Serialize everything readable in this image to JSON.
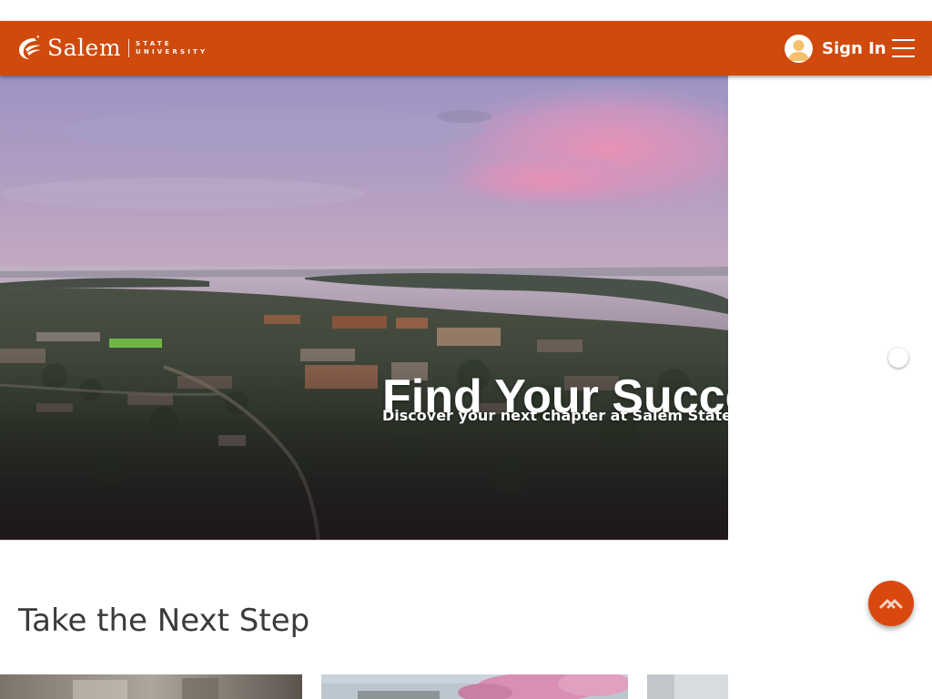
{
  "header": {
    "logo": {
      "wordmark": "Salem",
      "sub_line1": "STATE",
      "sub_line2": "UNIVERSITY"
    },
    "signin_label": "Sign In",
    "menu_icon": "hamburger-menu-icon",
    "avatar_icon": "user-avatar-icon",
    "brand_color": "#cf4a0c"
  },
  "hero": {
    "title": "Find Your Succes",
    "subtitle": "Discover your next chapter at Salem State Unive"
  },
  "section": {
    "title": "Take the Next Step"
  },
  "fab": {
    "icon": "chevron-up-icon",
    "color": "#d9480f"
  },
  "cards": [
    {
      "name": "card-1"
    },
    {
      "name": "card-2"
    },
    {
      "name": "card-3"
    }
  ]
}
